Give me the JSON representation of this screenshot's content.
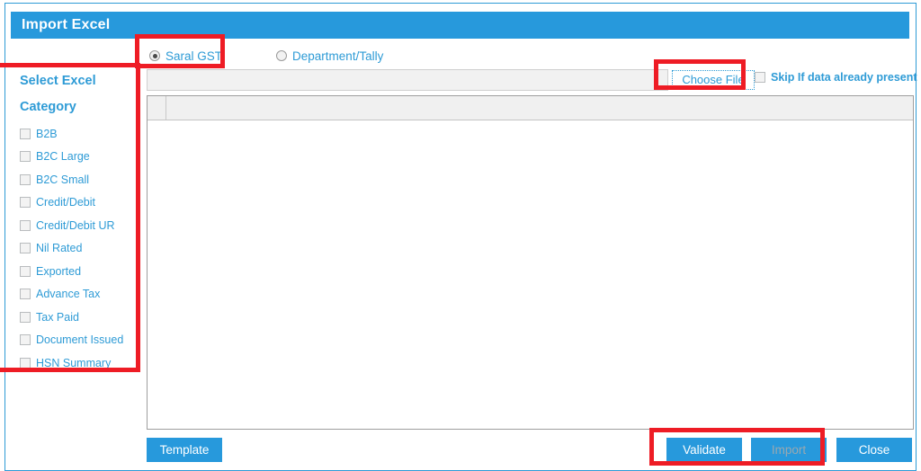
{
  "dialog": {
    "title": "Import Excel"
  },
  "source": {
    "options": [
      {
        "label": "Saral GST",
        "selected": true
      },
      {
        "label": "Department/Tally",
        "selected": false
      }
    ]
  },
  "sidebar": {
    "select_excel_heading": "Select Excel",
    "category_heading": "Category",
    "categories": [
      {
        "label": "B2B",
        "checked": false
      },
      {
        "label": "B2C Large",
        "checked": false
      },
      {
        "label": "B2C Small",
        "checked": false
      },
      {
        "label": "Credit/Debit",
        "checked": false
      },
      {
        "label": "Credit/Debit UR",
        "checked": false
      },
      {
        "label": "Nil Rated",
        "checked": false
      },
      {
        "label": "Exported",
        "checked": false
      },
      {
        "label": "Advance Tax",
        "checked": false
      },
      {
        "label": "Tax Paid",
        "checked": false
      },
      {
        "label": "Document Issued",
        "checked": false
      },
      {
        "label": "HSN Summary",
        "checked": false
      }
    ]
  },
  "file_row": {
    "path_value": "",
    "path_placeholder": "",
    "choose_file_label": "Choose File",
    "skip_label": "Skip If data already present",
    "skip_checked": false
  },
  "grid": {
    "rows": [],
    "columns": [
      "",
      ""
    ]
  },
  "actions": {
    "template_label": "Template",
    "validate_label": "Validate",
    "import_label": "Import",
    "import_disabled": true,
    "close_label": "Close"
  },
  "colors": {
    "accent_blue": "#2799dc",
    "link_blue": "#2e9bd6",
    "annotation_red": "#ee1c25",
    "disabled_text": "#9aa8b0"
  }
}
